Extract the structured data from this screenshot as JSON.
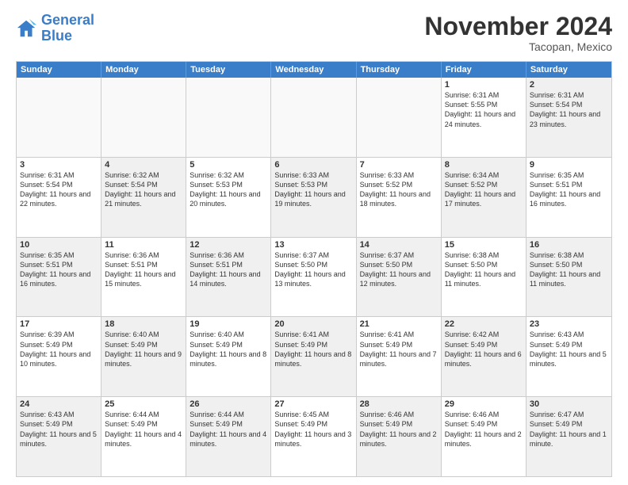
{
  "logo": {
    "line1": "General",
    "line2": "Blue"
  },
  "title": "November 2024",
  "subtitle": "Tacopan, Mexico",
  "header_days": [
    "Sunday",
    "Monday",
    "Tuesday",
    "Wednesday",
    "Thursday",
    "Friday",
    "Saturday"
  ],
  "weeks": [
    [
      {
        "day": "",
        "text": "",
        "empty": true
      },
      {
        "day": "",
        "text": "",
        "empty": true
      },
      {
        "day": "",
        "text": "",
        "empty": true
      },
      {
        "day": "",
        "text": "",
        "empty": true
      },
      {
        "day": "",
        "text": "",
        "empty": true
      },
      {
        "day": "1",
        "text": "Sunrise: 6:31 AM\nSunset: 5:55 PM\nDaylight: 11 hours and 24 minutes.",
        "empty": false
      },
      {
        "day": "2",
        "text": "Sunrise: 6:31 AM\nSunset: 5:54 PM\nDaylight: 11 hours and 23 minutes.",
        "empty": false,
        "shaded": true
      }
    ],
    [
      {
        "day": "3",
        "text": "Sunrise: 6:31 AM\nSunset: 5:54 PM\nDaylight: 11 hours and 22 minutes.",
        "empty": false
      },
      {
        "day": "4",
        "text": "Sunrise: 6:32 AM\nSunset: 5:54 PM\nDaylight: 11 hours and 21 minutes.",
        "empty": false,
        "shaded": true
      },
      {
        "day": "5",
        "text": "Sunrise: 6:32 AM\nSunset: 5:53 PM\nDaylight: 11 hours and 20 minutes.",
        "empty": false
      },
      {
        "day": "6",
        "text": "Sunrise: 6:33 AM\nSunset: 5:53 PM\nDaylight: 11 hours and 19 minutes.",
        "empty": false,
        "shaded": true
      },
      {
        "day": "7",
        "text": "Sunrise: 6:33 AM\nSunset: 5:52 PM\nDaylight: 11 hours and 18 minutes.",
        "empty": false
      },
      {
        "day": "8",
        "text": "Sunrise: 6:34 AM\nSunset: 5:52 PM\nDaylight: 11 hours and 17 minutes.",
        "empty": false,
        "shaded": true
      },
      {
        "day": "9",
        "text": "Sunrise: 6:35 AM\nSunset: 5:51 PM\nDaylight: 11 hours and 16 minutes.",
        "empty": false
      }
    ],
    [
      {
        "day": "10",
        "text": "Sunrise: 6:35 AM\nSunset: 5:51 PM\nDaylight: 11 hours and 16 minutes.",
        "empty": false,
        "shaded": true
      },
      {
        "day": "11",
        "text": "Sunrise: 6:36 AM\nSunset: 5:51 PM\nDaylight: 11 hours and 15 minutes.",
        "empty": false
      },
      {
        "day": "12",
        "text": "Sunrise: 6:36 AM\nSunset: 5:51 PM\nDaylight: 11 hours and 14 minutes.",
        "empty": false,
        "shaded": true
      },
      {
        "day": "13",
        "text": "Sunrise: 6:37 AM\nSunset: 5:50 PM\nDaylight: 11 hours and 13 minutes.",
        "empty": false
      },
      {
        "day": "14",
        "text": "Sunrise: 6:37 AM\nSunset: 5:50 PM\nDaylight: 11 hours and 12 minutes.",
        "empty": false,
        "shaded": true
      },
      {
        "day": "15",
        "text": "Sunrise: 6:38 AM\nSunset: 5:50 PM\nDaylight: 11 hours and 11 minutes.",
        "empty": false
      },
      {
        "day": "16",
        "text": "Sunrise: 6:38 AM\nSunset: 5:50 PM\nDaylight: 11 hours and 11 minutes.",
        "empty": false,
        "shaded": true
      }
    ],
    [
      {
        "day": "17",
        "text": "Sunrise: 6:39 AM\nSunset: 5:49 PM\nDaylight: 11 hours and 10 minutes.",
        "empty": false
      },
      {
        "day": "18",
        "text": "Sunrise: 6:40 AM\nSunset: 5:49 PM\nDaylight: 11 hours and 9 minutes.",
        "empty": false,
        "shaded": true
      },
      {
        "day": "19",
        "text": "Sunrise: 6:40 AM\nSunset: 5:49 PM\nDaylight: 11 hours and 8 minutes.",
        "empty": false
      },
      {
        "day": "20",
        "text": "Sunrise: 6:41 AM\nSunset: 5:49 PM\nDaylight: 11 hours and 8 minutes.",
        "empty": false,
        "shaded": true
      },
      {
        "day": "21",
        "text": "Sunrise: 6:41 AM\nSunset: 5:49 PM\nDaylight: 11 hours and 7 minutes.",
        "empty": false
      },
      {
        "day": "22",
        "text": "Sunrise: 6:42 AM\nSunset: 5:49 PM\nDaylight: 11 hours and 6 minutes.",
        "empty": false,
        "shaded": true
      },
      {
        "day": "23",
        "text": "Sunrise: 6:43 AM\nSunset: 5:49 PM\nDaylight: 11 hours and 5 minutes.",
        "empty": false
      }
    ],
    [
      {
        "day": "24",
        "text": "Sunrise: 6:43 AM\nSunset: 5:49 PM\nDaylight: 11 hours and 5 minutes.",
        "empty": false,
        "shaded": true
      },
      {
        "day": "25",
        "text": "Sunrise: 6:44 AM\nSunset: 5:49 PM\nDaylight: 11 hours and 4 minutes.",
        "empty": false
      },
      {
        "day": "26",
        "text": "Sunrise: 6:44 AM\nSunset: 5:49 PM\nDaylight: 11 hours and 4 minutes.",
        "empty": false,
        "shaded": true
      },
      {
        "day": "27",
        "text": "Sunrise: 6:45 AM\nSunset: 5:49 PM\nDaylight: 11 hours and 3 minutes.",
        "empty": false
      },
      {
        "day": "28",
        "text": "Sunrise: 6:46 AM\nSunset: 5:49 PM\nDaylight: 11 hours and 2 minutes.",
        "empty": false,
        "shaded": true
      },
      {
        "day": "29",
        "text": "Sunrise: 6:46 AM\nSunset: 5:49 PM\nDaylight: 11 hours and 2 minutes.",
        "empty": false
      },
      {
        "day": "30",
        "text": "Sunrise: 6:47 AM\nSunset: 5:49 PM\nDaylight: 11 hours and 1 minute.",
        "empty": false,
        "shaded": true
      }
    ]
  ]
}
